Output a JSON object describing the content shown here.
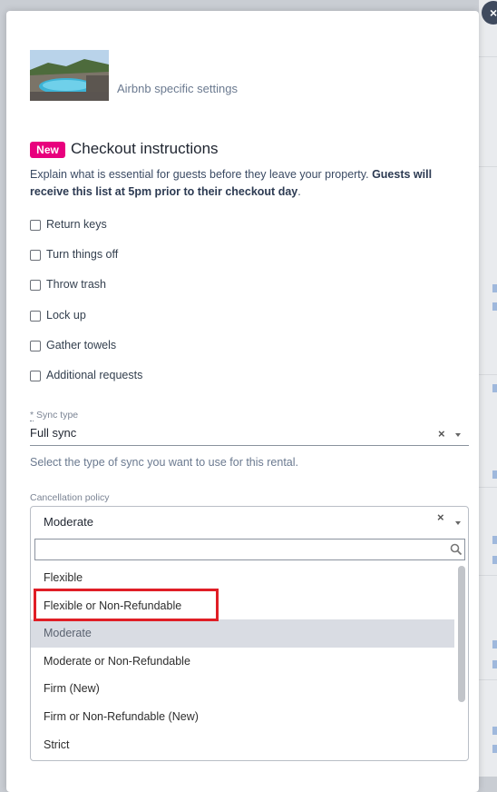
{
  "modal": {
    "close_label": "×",
    "airbnb_label": "Airbnb specific settings"
  },
  "checkout": {
    "badge": "New",
    "title": "Checkout instructions",
    "description_plain": "Explain what is essential for guests before they leave your property. ",
    "description_bold": "Guests will receive this list at 5pm prior to their checkout day",
    "description_end": ".",
    "items": [
      {
        "label": "Return keys",
        "checked": false
      },
      {
        "label": "Turn things off",
        "checked": false
      },
      {
        "label": "Throw trash",
        "checked": false
      },
      {
        "label": "Lock up",
        "checked": false
      },
      {
        "label": "Gather towels",
        "checked": false
      },
      {
        "label": "Additional requests",
        "checked": false
      }
    ]
  },
  "sync_type": {
    "required_mark": "*",
    "label": " Sync type",
    "value": "Full sync",
    "clear": "×",
    "help": "Select the type of sync you want to use for this rental."
  },
  "cancellation": {
    "label": "Cancellation policy",
    "value": "Moderate",
    "clear": "×",
    "search_placeholder": "",
    "options": [
      {
        "label": "Flexible",
        "selected": false
      },
      {
        "label": "Flexible or Non-Refundable",
        "selected": false,
        "highlighted": true
      },
      {
        "label": "Moderate",
        "selected": true
      },
      {
        "label": "Moderate or Non-Refundable",
        "selected": false
      },
      {
        "label": "Firm (New)",
        "selected": false
      },
      {
        "label": "Firm or Non-Refundable (New)",
        "selected": false
      },
      {
        "label": "Strict",
        "selected": false
      }
    ]
  },
  "colors": {
    "badge": "#e8007d",
    "highlight": "#e01e26",
    "selected_option": "#d9dce3",
    "close_button": "#3f4a5e"
  }
}
